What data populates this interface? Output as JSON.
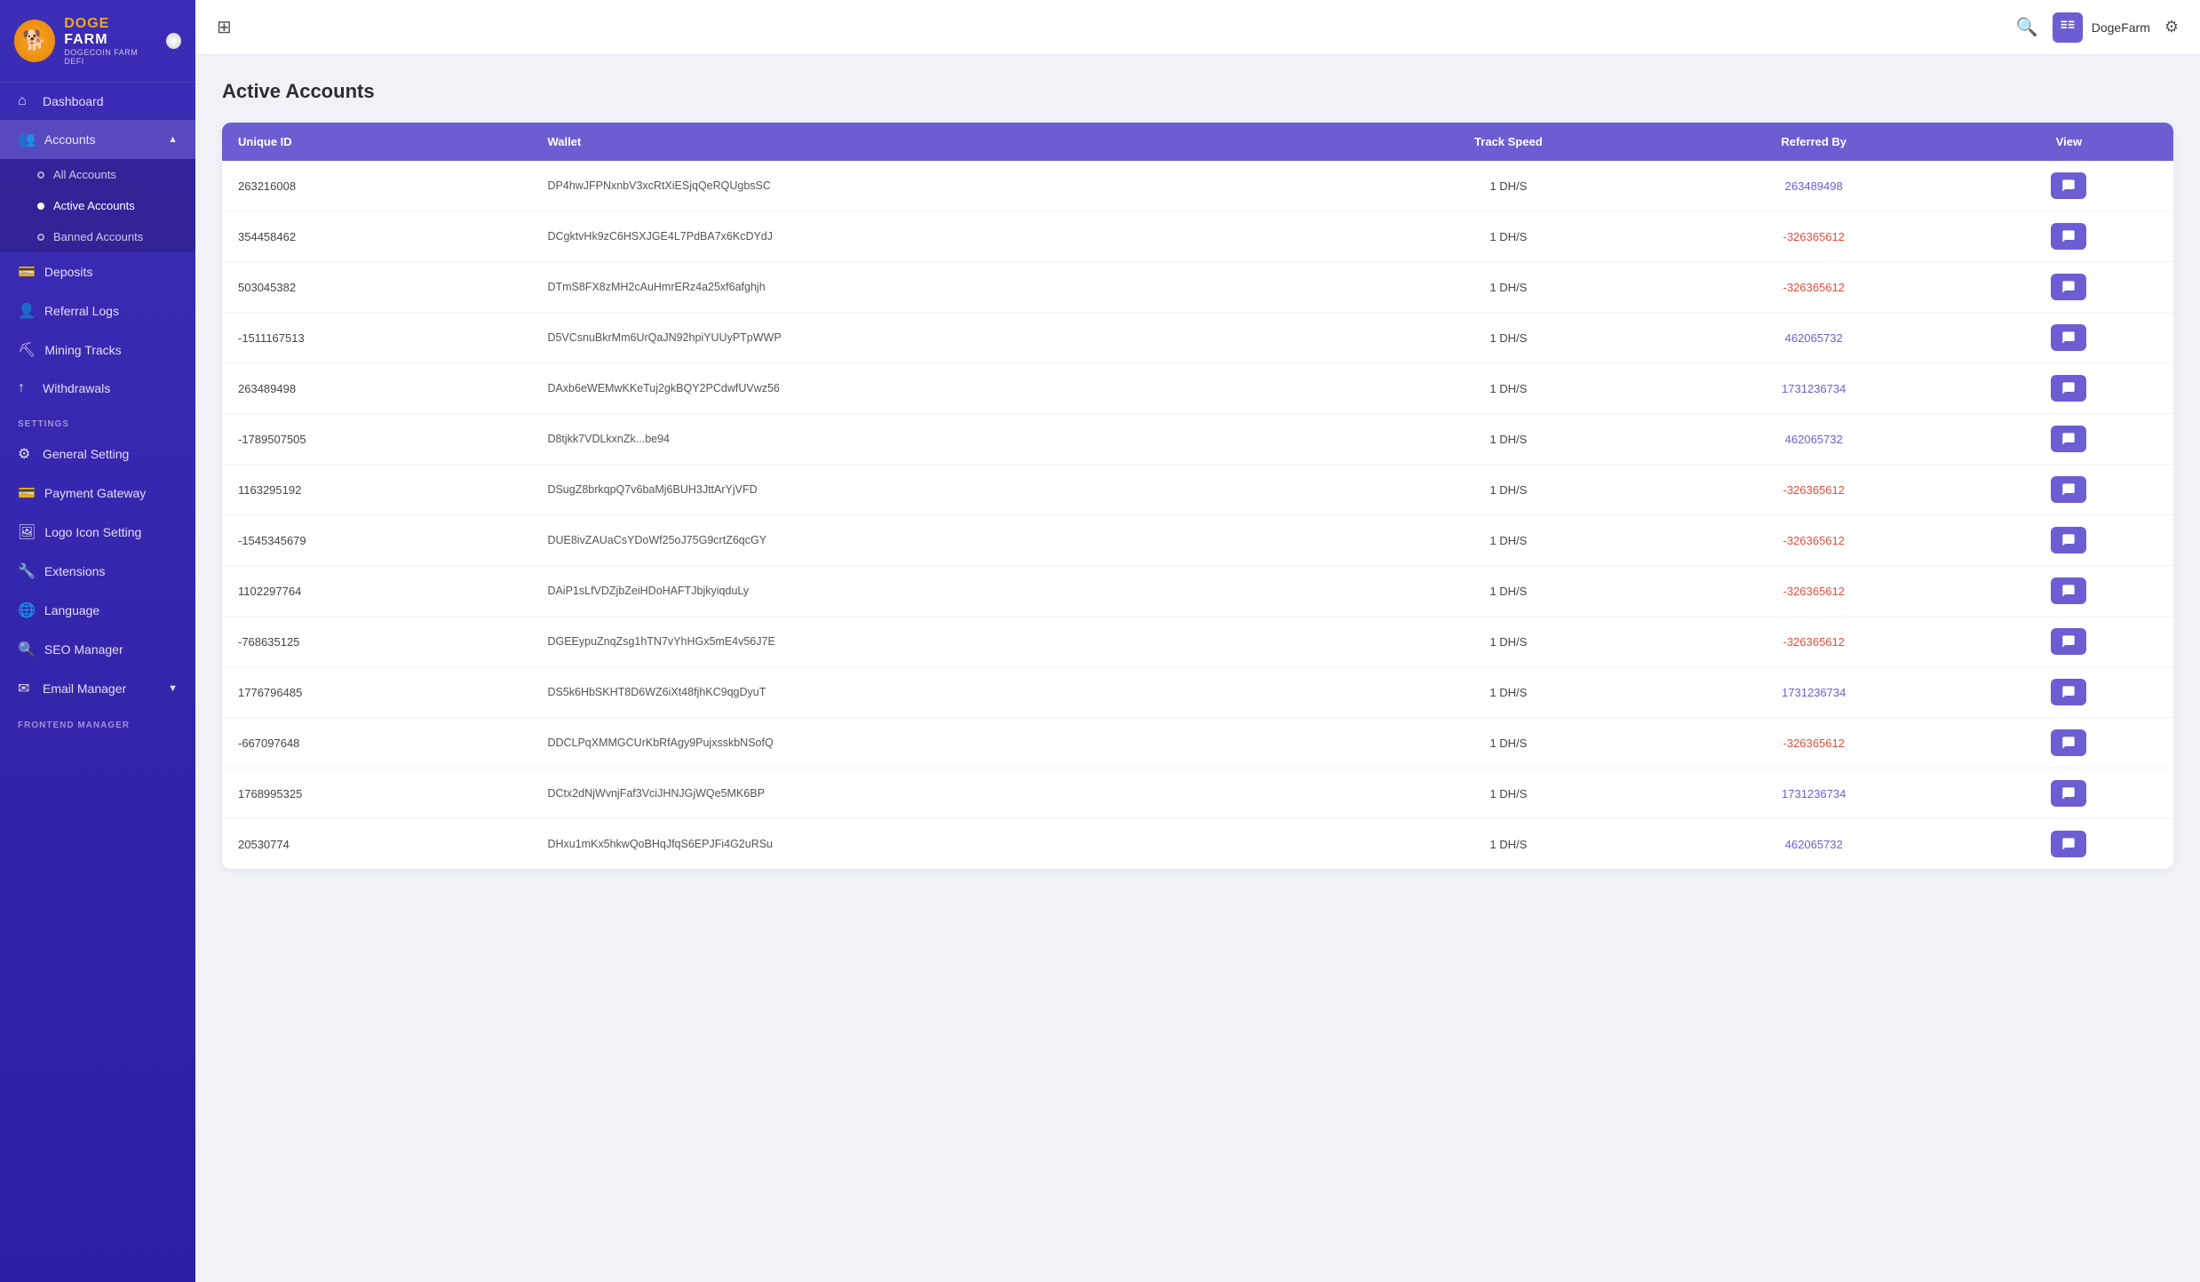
{
  "app": {
    "logo_emoji": "🐕",
    "title_doge": "DOGE",
    "title_farm": " FARM",
    "subtitle": "DOGECOIN FARM DEFI"
  },
  "sidebar": {
    "nav": [
      {
        "id": "dashboard",
        "label": "Dashboard",
        "icon": "⌂",
        "active": false
      },
      {
        "id": "accounts",
        "label": "Accounts",
        "icon": "👥",
        "active": true,
        "expanded": true
      },
      {
        "id": "all-accounts",
        "label": "All Accounts",
        "sub": true,
        "active": false
      },
      {
        "id": "active-accounts",
        "label": "Active Accounts",
        "sub": true,
        "active": true
      },
      {
        "id": "banned-accounts",
        "label": "Banned Accounts",
        "sub": true,
        "active": false
      },
      {
        "id": "deposits",
        "label": "Deposits",
        "icon": "💳",
        "active": false
      },
      {
        "id": "referral-logs",
        "label": "Referral Logs",
        "icon": "👤",
        "active": false
      },
      {
        "id": "mining-tracks",
        "label": "Mining Tracks",
        "icon": "⛏",
        "active": false
      },
      {
        "id": "withdrawals",
        "label": "Withdrawals",
        "icon": "↑",
        "active": false
      }
    ],
    "settings_label": "SETTINGS",
    "settings_nav": [
      {
        "id": "general-setting",
        "label": "General Setting",
        "icon": "⚙"
      },
      {
        "id": "payment-gateway",
        "label": "Payment Gateway",
        "icon": "💳"
      },
      {
        "id": "logo-icon-setting",
        "label": "Logo Icon Setting",
        "icon": "🖼"
      },
      {
        "id": "extensions",
        "label": "Extensions",
        "icon": "🔧"
      },
      {
        "id": "language",
        "label": "Language",
        "icon": "🌐"
      },
      {
        "id": "seo-manager",
        "label": "SEO Manager",
        "icon": "🔍"
      },
      {
        "id": "email-manager",
        "label": "Email Manager",
        "icon": "✉",
        "chevron": true
      }
    ],
    "frontend_label": "FRONTEND MANAGER"
  },
  "topbar": {
    "expand_icon": "⊞",
    "search_icon": "🔍",
    "user_name": "DogeFarm",
    "settings_icon": "⚙"
  },
  "page": {
    "title": "Active Accounts"
  },
  "table": {
    "headers": [
      "Unique ID",
      "Wallet",
      "Track Speed",
      "Referred By",
      "View"
    ],
    "rows": [
      {
        "id": "263216008",
        "wallet": "DP4hwJFPNxnbV3xcRtXiESjqQeRQUgbsSC",
        "speed": "1 DH/S",
        "referred": "263489498",
        "referred_color": "blue"
      },
      {
        "id": "354458462",
        "wallet": "DCgktvHk9zC6HSXJGE4L7PdBA7x6KcDYdJ",
        "speed": "1 DH/S",
        "referred": "-326365612",
        "referred_color": "red"
      },
      {
        "id": "503045382",
        "wallet": "DTmS8FX8zMH2cAuHmrERz4a25xf6afghjh",
        "speed": "1 DH/S",
        "referred": "-326365612",
        "referred_color": "red"
      },
      {
        "id": "-1511167513",
        "wallet": "D5VCsnuBkrMm6UrQaJN92hpiYUUyPTpWWP",
        "speed": "1 DH/S",
        "referred": "462065732",
        "referred_color": "blue"
      },
      {
        "id": "263489498",
        "wallet": "DAxb6eWEMwKKeTuj2gkBQY2PCdwfUVwz56",
        "speed": "1 DH/S",
        "referred": "1731236734",
        "referred_color": "blue"
      },
      {
        "id": "-1789507505",
        "wallet": "D8tjkk7VDLkxnZk...be94",
        "speed": "1 DH/S",
        "referred": "462065732",
        "referred_color": "blue"
      },
      {
        "id": "1163295192",
        "wallet": "DSugZ8brkqpQ7v6baMj6BUH3JttArYjVFD",
        "speed": "1 DH/S",
        "referred": "-326365612",
        "referred_color": "red"
      },
      {
        "id": "-1545345679",
        "wallet": "DUE8ivZAUaCsYDoWf25oJ75G9crtZ6qcGY",
        "speed": "1 DH/S",
        "referred": "-326365612",
        "referred_color": "red"
      },
      {
        "id": "1102297764",
        "wallet": "DAiP1sLfVDZjbZeiHDoHAFTJbjkyiqduLy",
        "speed": "1 DH/S",
        "referred": "-326365612",
        "referred_color": "red"
      },
      {
        "id": "-768635125",
        "wallet": "DGEEypuZnqZsg1hTN7vYhHGx5mE4v56J7E",
        "speed": "1 DH/S",
        "referred": "-326365612",
        "referred_color": "red"
      },
      {
        "id": "1776796485",
        "wallet": "DS5k6HbSKHT8D6WZ6iXt48fjhKC9qgDyuT",
        "speed": "1 DH/S",
        "referred": "1731236734",
        "referred_color": "blue"
      },
      {
        "id": "-667097648",
        "wallet": "DDCLPqXMMGCUrKbRfAgy9PujxsskbNSofQ",
        "speed": "1 DH/S",
        "referred": "-326365612",
        "referred_color": "red"
      },
      {
        "id": "1768995325",
        "wallet": "DCtx2dNjWvnjFaf3VciJHNJGjWQe5MK6BP",
        "speed": "1 DH/S",
        "referred": "1731236734",
        "referred_color": "blue"
      },
      {
        "id": "20530774",
        "wallet": "DHxu1mKx5hkwQoBHqJfqS6EPJFi4G2uRSu",
        "speed": "1 DH/S",
        "referred": "462065732",
        "referred_color": "blue"
      }
    ]
  }
}
